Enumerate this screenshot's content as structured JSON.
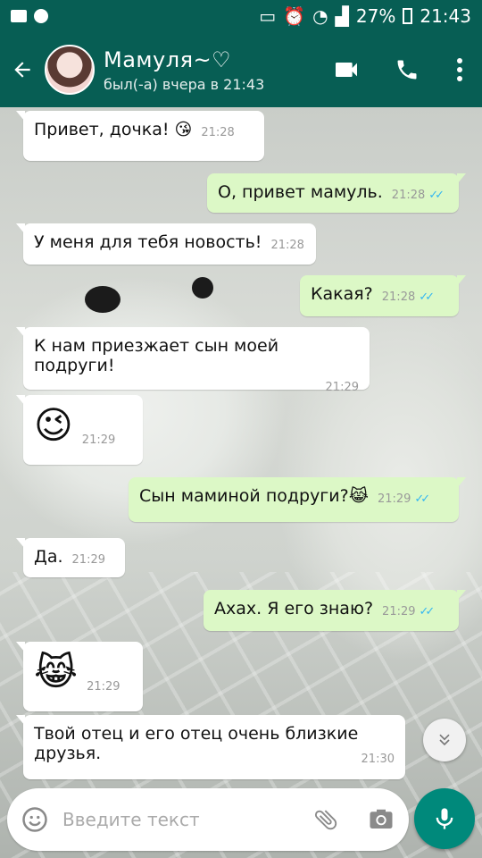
{
  "status_bar": {
    "battery": "27%",
    "time": "21:43"
  },
  "header": {
    "contact_name": "Мамуля~♡",
    "last_seen": "был(-а) вчера в 21:43"
  },
  "messages": [
    {
      "direction": "in",
      "text": "Привет, дочка! 😘",
      "time": "21:28"
    },
    {
      "direction": "out",
      "text": "О, привет мамуль.",
      "time": "21:28",
      "read": true
    },
    {
      "direction": "in",
      "text": "У меня для тебя новость!",
      "time": "21:28"
    },
    {
      "direction": "out",
      "text": "Какая?",
      "time": "21:28",
      "read": true
    },
    {
      "direction": "in",
      "text": "К нам приезжает сын моей подруги!",
      "time": "21:29"
    },
    {
      "direction": "in",
      "text": "😉",
      "time": "21:29"
    },
    {
      "direction": "out",
      "text": "Сын маминой подруги?😹",
      "time": "21:29",
      "read": true
    },
    {
      "direction": "in",
      "text": "Да.",
      "time": "21:29"
    },
    {
      "direction": "out",
      "text": "Ахах. Я его знаю?",
      "time": "21:29",
      "read": true
    },
    {
      "direction": "in",
      "text": "😹",
      "time": "21:29"
    },
    {
      "direction": "in",
      "text": "Твой отец и его отец очень близкие друзья.",
      "time": "21:30"
    }
  ],
  "composer": {
    "placeholder": "Введите текст",
    "value": ""
  },
  "colors": {
    "header": "#075e54",
    "outgoing_bubble": "#dcf8c6",
    "incoming_bubble": "#ffffff",
    "read_ticks": "#34b7f1",
    "mic_button": "#00897b"
  },
  "icons": {
    "back": "arrow-left-icon",
    "video": "video-camera-icon",
    "call": "phone-icon",
    "menu": "more-vert-icon",
    "emoji": "emoji-icon",
    "attach": "paperclip-icon",
    "camera": "camera-icon",
    "mic": "microphone-icon",
    "scroll": "chevron-double-down-icon"
  }
}
